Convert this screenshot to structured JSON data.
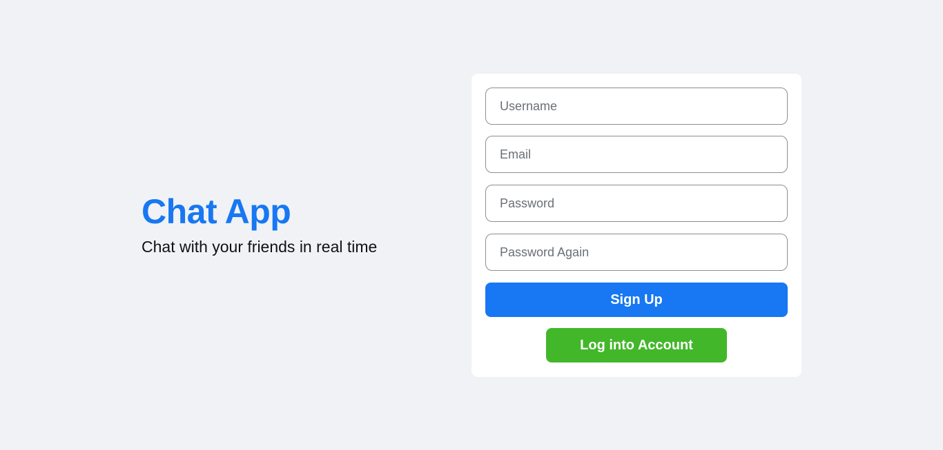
{
  "brand": {
    "title": "Chat App",
    "subtitle": "Chat with your friends in real time"
  },
  "form": {
    "username_placeholder": "Username",
    "email_placeholder": "Email",
    "password_placeholder": "Password",
    "password_again_placeholder": "Password Again",
    "signup_label": "Sign Up",
    "login_label": "Log into Account"
  },
  "colors": {
    "background": "#f0f2f5",
    "primary": "#1877f2",
    "success": "#42b72a",
    "card": "#ffffff"
  }
}
